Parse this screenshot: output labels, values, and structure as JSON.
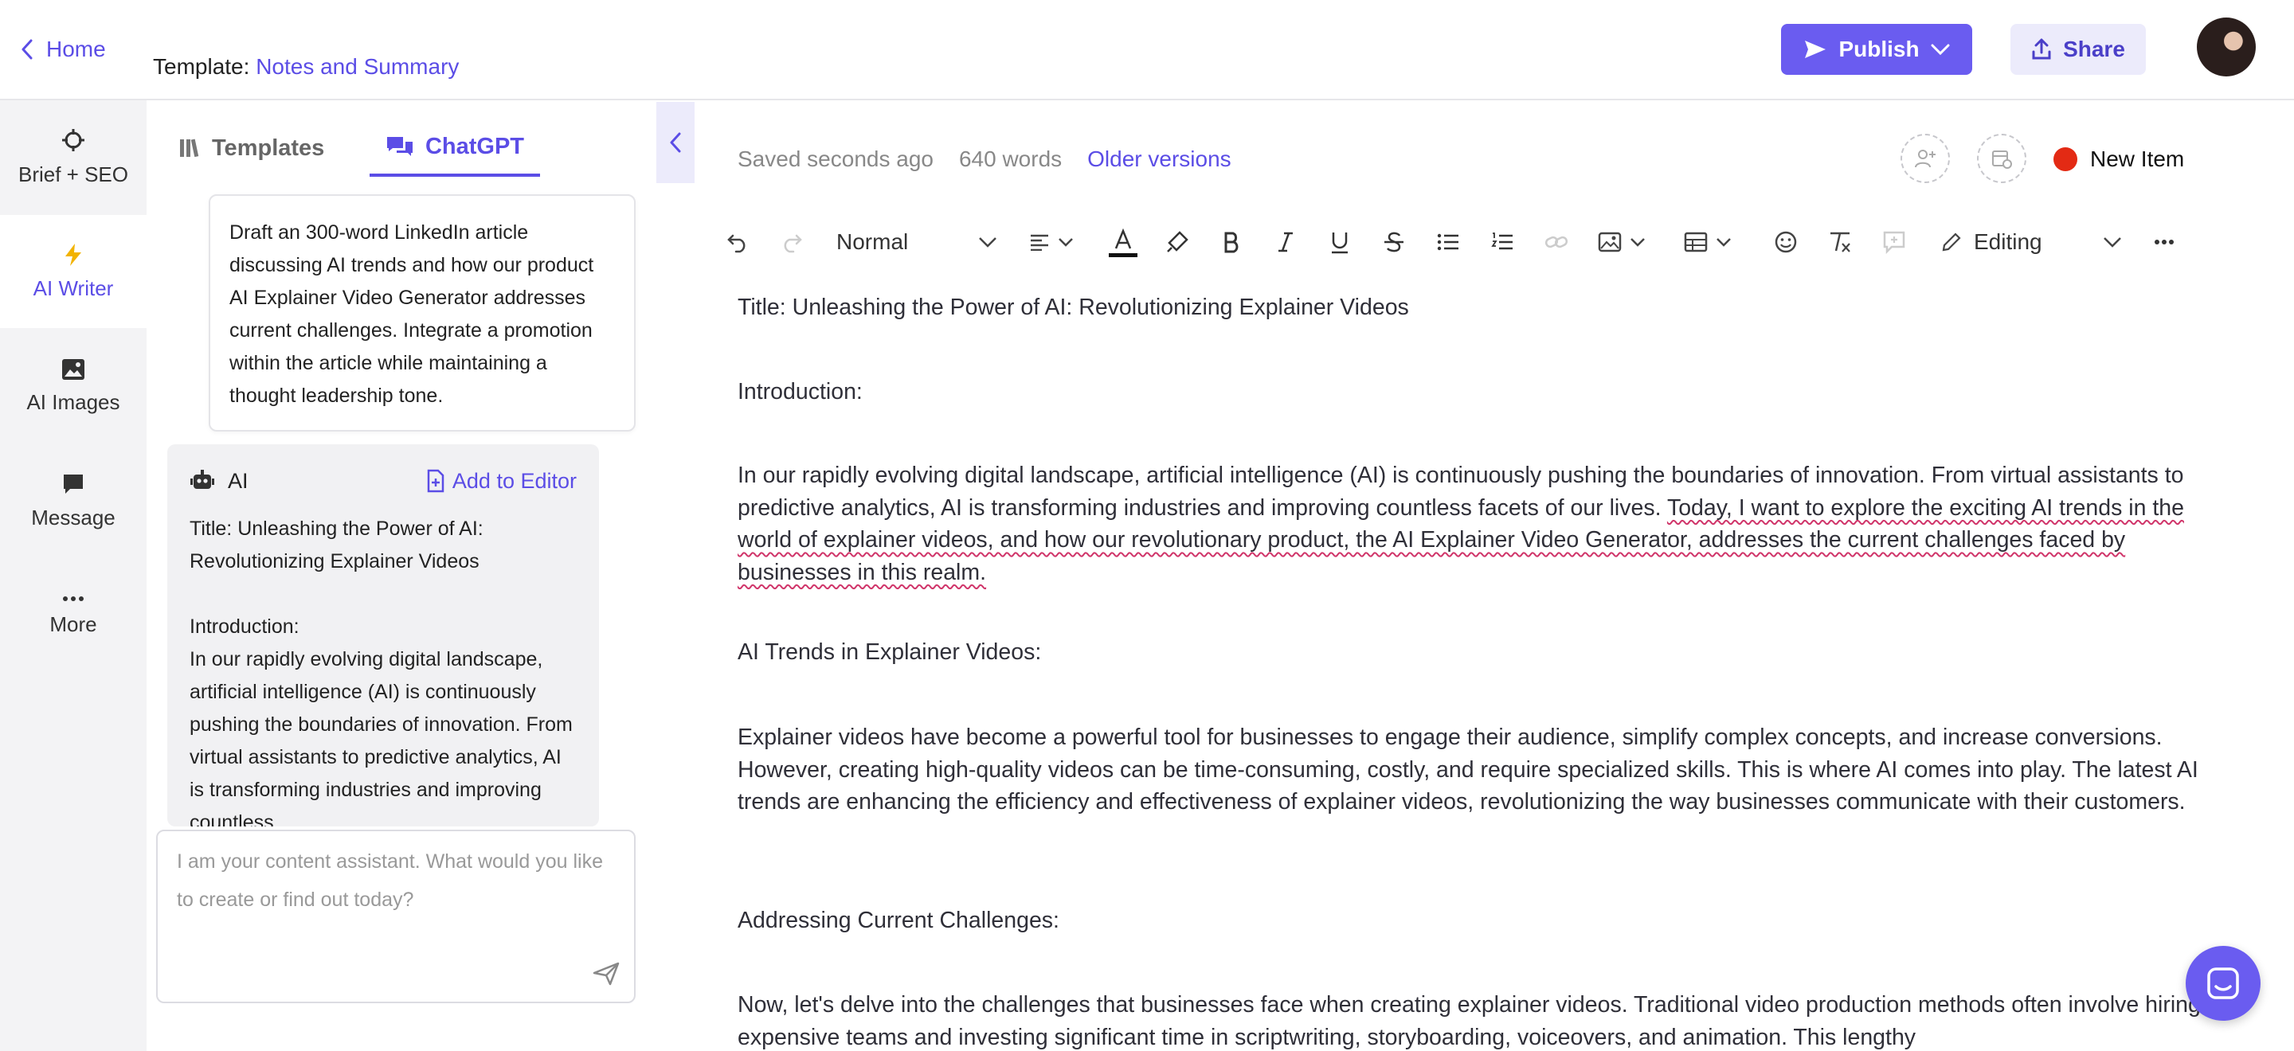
{
  "header": {
    "home_label": "Home",
    "template_prefix": "Template:",
    "template_name": "Notes and Summary",
    "publish_label": "Publish",
    "share_label": "Share"
  },
  "nav": {
    "items": [
      {
        "label": "Brief + SEO",
        "icon": "crosshair-icon"
      },
      {
        "label": "AI Writer",
        "icon": "bolt-icon"
      },
      {
        "label": "AI Images",
        "icon": "image-icon"
      },
      {
        "label": "Message",
        "icon": "message-icon"
      },
      {
        "label": "More",
        "icon": "more-dots-icon"
      }
    ],
    "active": "AI Writer"
  },
  "panel": {
    "tabs": [
      {
        "label": "Templates",
        "icon": "templates-icon"
      },
      {
        "label": "ChatGPT",
        "icon": "chat-bubbles-icon"
      }
    ],
    "active_tab": "ChatGPT",
    "prompt": "Draft an 300-word LinkedIn article discussing AI trends and how our product AI Explainer Video Generator addresses current challenges. Integrate a promotion within the article while maintaining a thought leadership tone.",
    "ai_label": "AI",
    "add_to_editor_label": "Add to Editor",
    "ai_response": "Title: Unleashing the Power of AI: Revolutionizing Explainer Videos\n\nIntroduction:\nIn our rapidly evolving digital landscape, artificial intelligence (AI) is continuously pushing the boundaries of innovation. From virtual assistants to predictive analytics, AI is transforming industries and improving countless",
    "input_placeholder": "I am your content assistant. What would you like to create or find out today?"
  },
  "editor": {
    "saved_status": "Saved seconds ago",
    "word_count": "640 words",
    "older_versions": "Older versions",
    "item_status": "New Item",
    "item_status_color": "#e32a14",
    "toolbar": {
      "paragraph_style": "Normal",
      "mode": "Editing"
    },
    "content": {
      "title": "Title: Unleashing the Power of AI: Revolutionizing Explainer Videos",
      "intro_heading": "Introduction:",
      "intro_a": "In our rapidly evolving digital landscape, artificial intelligence (AI) is continuously pushing the boundaries of innovation. From virtual assistants to predictive analytics, AI is transforming industries and improving countless facets of our lives. ",
      "intro_b": "Today, I want to explore the exciting AI trends in the world of explainer videos, and how our revolutionary product, the AI Explainer Video Generator, addresses the current challenges faced by businesses in this realm.",
      "trends_heading": "AI Trends in Explainer Videos:",
      "trends_body": "Explainer videos have become a powerful tool for businesses to engage their audience, simplify complex concepts, and increase conversions. However, creating high-quality videos can be time-consuming, costly, and require specialized skills. This is where AI comes into play. The latest AI trends are enhancing the efficiency and effectiveness of explainer videos, revolutionizing the way businesses communicate with their customers.",
      "challenges_heading": "Addressing Current Challenges:",
      "challenges_body": "Now, let's delve into the challenges that businesses face when creating explainer videos. Traditional video production methods often involve hiring expensive teams and investing significant time in scriptwriting, storyboarding, voiceovers, and animation. This lengthy"
    }
  },
  "colors": {
    "accent": "#6a5cf0",
    "accent_text": "#5b4de6"
  }
}
